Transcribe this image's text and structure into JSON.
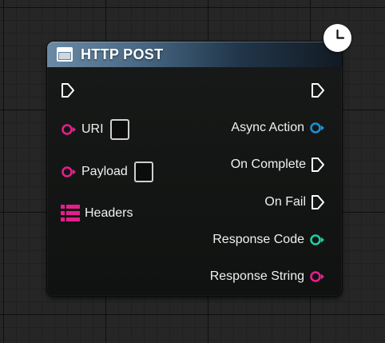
{
  "node": {
    "title": "HTTP POST",
    "header_icon": "function-node-icon",
    "latent_icon": "clock-icon",
    "inputs": [
      {
        "label": "URI",
        "pin": "string-pin",
        "color": "#e61e8c"
      },
      {
        "label": "Payload",
        "pin": "string-pin",
        "color": "#e61e8c"
      },
      {
        "label": "Headers",
        "pin": "map-pin",
        "color": "#e61e8c"
      }
    ],
    "outputs": [
      {
        "label": "Async Action",
        "pin": "object-pin",
        "color": "#1a90d8"
      },
      {
        "label": "On Complete",
        "pin": "exec-pin",
        "color": "#ffffff"
      },
      {
        "label": "On Fail",
        "pin": "exec-pin",
        "color": "#ffffff"
      },
      {
        "label": "Response Code",
        "pin": "integer-pin",
        "color": "#1ecca3"
      },
      {
        "label": "Response String",
        "pin": "string-pin",
        "color": "#e61e8c"
      }
    ]
  }
}
